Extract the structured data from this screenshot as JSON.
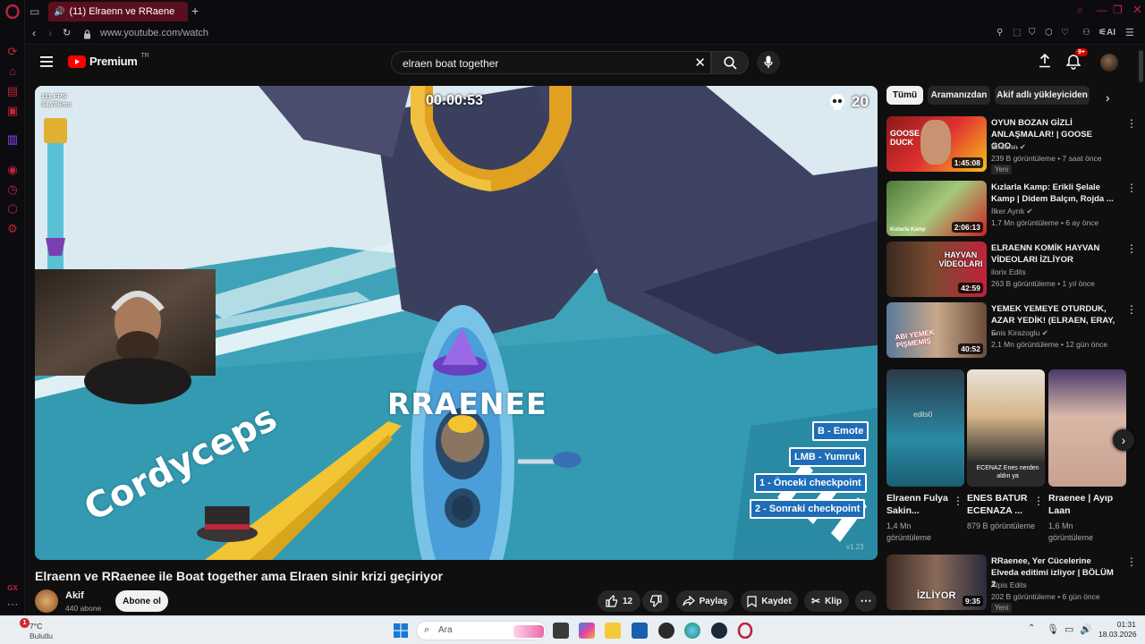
{
  "browser": {
    "tab_title": "(11) Elraenn ve RRaene",
    "url": "www.youtube.com/watch",
    "ai_label": "AI",
    "sidebar_badge": "GX"
  },
  "header": {
    "logo_text": "Premium",
    "region": "TR",
    "search_value": "elraen boat together",
    "notification_count": "9+"
  },
  "video": {
    "fps": "111 FPS",
    "ms": "34,786ms",
    "timer": "00:00:53",
    "skull_count": "20",
    "player_name": "RRAENEE",
    "other_player": "Cordyceps",
    "keys": [
      "B - Emote",
      "LMB - Yumruk",
      "1 - Önceki checkpoint",
      "2 - Sonraki checkpoint"
    ],
    "version": "v1.23"
  },
  "below": {
    "title": "Elraenn ve RRaenee ile Boat together ama Elraen sinir krizi geçiriyor",
    "channel": "Akif",
    "subscribers": "440 abone",
    "subscribe_label": "Abone ol",
    "likes": "12",
    "share_label": "Paylaş",
    "save_label": "Kaydet",
    "clip_label": "Klip"
  },
  "chips": [
    "Tümü",
    "Aramanızdan",
    "Akif adlı yükleyiciden"
  ],
  "recommendations": [
    {
      "title": "OYUN BOZAN GİZLİ ANLAŞMALAR! | GOOSE GOO...",
      "channel": "Elraenn",
      "meta": "239 B görüntüleme • 7 saat önce",
      "duration": "1:45:08",
      "badge": "Yeni",
      "verified": true,
      "thumb_text": "GOOSE DUCK"
    },
    {
      "title": "Kızlarla Kamp: Erikli Şelale Kamp | Didem Balçın, Rojda ...",
      "channel": "İlker Ayrık",
      "meta": "1,7 Mn görüntüleme • 6 ay önce",
      "duration": "2:06:13",
      "badge": "",
      "verified": true,
      "thumb_text": "Kızlarla Kamp"
    },
    {
      "title": "ELRAENN KOMİK HAYVAN VİDEOLARI İZLİYOR",
      "channel": "ilorix Edits",
      "meta": "263 B görüntüleme • 1 yıl önce",
      "duration": "42:59",
      "badge": "",
      "verified": false,
      "thumb_text": "HAYVAN VİDEOLARI"
    },
    {
      "title": "YEMEK YEMEYE OTURDUK, AZAR YEDİK! (ELRAEN, ERAY, ...",
      "channel": "Enis Kirazoglu",
      "meta": "2,1 Mn görüntüleme • 12 gün önce",
      "duration": "40:52",
      "badge": "",
      "verified": true,
      "thumb_text": "ABI YEMEK PİŞMEMİŞ"
    },
    {
      "title": "RRaenee, Yer Cücelerine Elveda editimi izliyor | BÖLÜM 2",
      "channel": "Alpis Edits",
      "meta": "202 B görüntüleme • 6 gün önce",
      "duration": "9:35",
      "badge": "Yeni",
      "verified": false,
      "thumb_text": "İZLİYOR"
    }
  ],
  "shorts": [
    {
      "title": "Elraenn Fulya Sakin...",
      "views": "1,4 Mn görüntüleme",
      "overlay": "edits0"
    },
    {
      "title": "ENES BATUR ECENAZA ...",
      "views": "879 B görüntüleme",
      "overlay": "ECENAZ Enes nerden aldın ya"
    },
    {
      "title": "Rraenee | Ayıp Laan",
      "views": "1,6 Mn görüntüleme",
      "overlay": ""
    }
  ],
  "taskbar": {
    "weather_temp": "7°C",
    "weather_desc": "Bulutlu",
    "search_placeholder": "Ara",
    "time": "01:31",
    "date": "18.03.2026",
    "notification_badge": "1"
  },
  "colors": {
    "opera_red": "#c0233c",
    "yt_red": "#ff0000",
    "key_blue": "#1d6db8"
  }
}
